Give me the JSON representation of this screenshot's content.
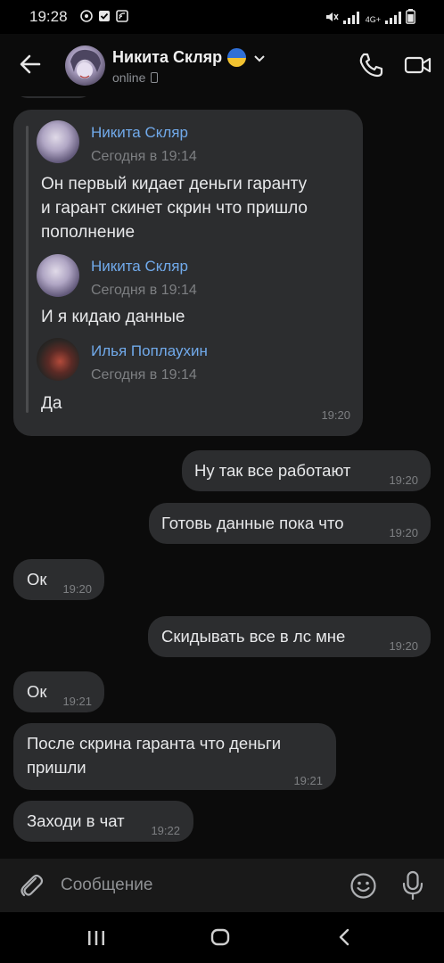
{
  "status_bar": {
    "time": "19:28",
    "network_label": "4G+"
  },
  "header": {
    "name": "Никита Скляр",
    "status": "online"
  },
  "forwarded": {
    "time": "19:20",
    "items": [
      {
        "name": "Никита Скляр",
        "date": "Сегодня в 19:14",
        "text_lines": [
          "Он первый кидает деньги гаранту",
          "и гарант скинет скрин что пришло",
          "пополнение"
        ]
      },
      {
        "name": "Никита Скляр",
        "date": "Сегодня в 19:14",
        "text_lines": [
          "И я кидаю данные"
        ]
      },
      {
        "name": "Илья Поплаухин",
        "date": "Сегодня в 19:14",
        "text_lines": [
          "Да"
        ]
      }
    ]
  },
  "messages": [
    {
      "dir": "out",
      "text": "Ну так все работают",
      "time": "19:20"
    },
    {
      "dir": "out",
      "text": "Готовь данные пока что",
      "time": "19:20"
    },
    {
      "dir": "in",
      "text": "Ок",
      "time": "19:20"
    },
    {
      "dir": "out",
      "text": "Скидывать все в лс мне",
      "time": "19:20"
    },
    {
      "dir": "in",
      "text": "Ок",
      "time": "19:21"
    },
    {
      "dir": "in",
      "text_lines": [
        "После скрина гаранта что деньги",
        "пришли"
      ],
      "time": "19:21"
    },
    {
      "dir": "in",
      "text": "Заходи в чат",
      "time": "19:22"
    }
  ],
  "composer": {
    "placeholder": "Сообщение"
  },
  "colors": {
    "bubble": "#2c2d2f",
    "accent_name": "#71aaeb",
    "background": "#0b0b0b"
  }
}
